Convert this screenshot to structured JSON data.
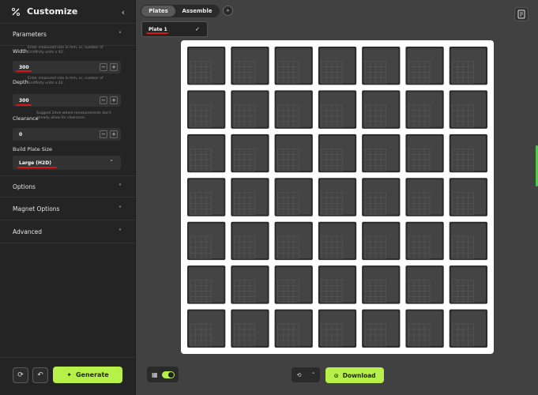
{
  "app": {
    "title": "Customize"
  },
  "sidebar": {
    "sections": {
      "parameters": "Parameters",
      "options": "Options",
      "magnet_options": "Magnet Options",
      "advanced": "Advanced"
    },
    "width": {
      "label": "Width",
      "help": "Enter measured size in mm, or, number of Gridfinity units x 42.",
      "value": "300"
    },
    "depth": {
      "label": "Depth",
      "help": "Enter measured size in mm, or, number of Gridfinity units x 42.",
      "value": "300"
    },
    "clearance": {
      "label": "Clearance",
      "help": "Suggest 2mm where measurements don't already allow for clearance.",
      "value": "0"
    },
    "build_plate": {
      "label": "Build Plate Size",
      "value": "Large (H2D)"
    },
    "generate_label": "Generate"
  },
  "tabs": [
    {
      "label": "Plates"
    },
    {
      "label": "Assemble"
    }
  ],
  "plate_chip": {
    "label": "Plate 1"
  },
  "bottom": {
    "download_label": "Download"
  },
  "grid": {
    "rows": 7,
    "cols": 7
  },
  "colors": {
    "accent": "#b8f04a",
    "plate": "#ffffff",
    "cell": "#444444",
    "annotation": "#d8141b"
  }
}
